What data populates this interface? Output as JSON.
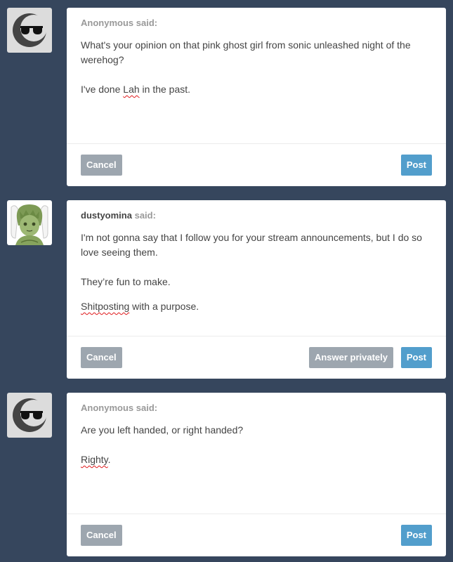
{
  "said_label": "said:",
  "buttons": {
    "cancel": "Cancel",
    "answer_privately": "Answer privately",
    "post": "Post"
  },
  "posts": [
    {
      "asker": "Anonymous",
      "avatar": "anonymous-sunglasses-moon-icon",
      "question": "What's your opinion on that pink ghost girl from sonic unleashed night of the werehog?",
      "answer": [
        {
          "before": "I've done ",
          "flagged": "Lah",
          "after": " in the past."
        }
      ]
    },
    {
      "asker": "dustyomina",
      "avatar": "green-character-avatar",
      "question": "I'm not gonna say that I follow you for your stream announcements, but I do so love seeing them.",
      "answer": [
        {
          "before": "They’re fun to make.",
          "flagged": "",
          "after": ""
        },
        {
          "before": "",
          "flagged": "Shitposting",
          "after": " with a purpose."
        }
      ]
    },
    {
      "asker": "Anonymous",
      "avatar": "anonymous-sunglasses-moon-icon",
      "question": "Are you left handed, or right handed?",
      "answer": [
        {
          "before": "",
          "flagged": "Righty",
          "after": "."
        }
      ]
    }
  ]
}
